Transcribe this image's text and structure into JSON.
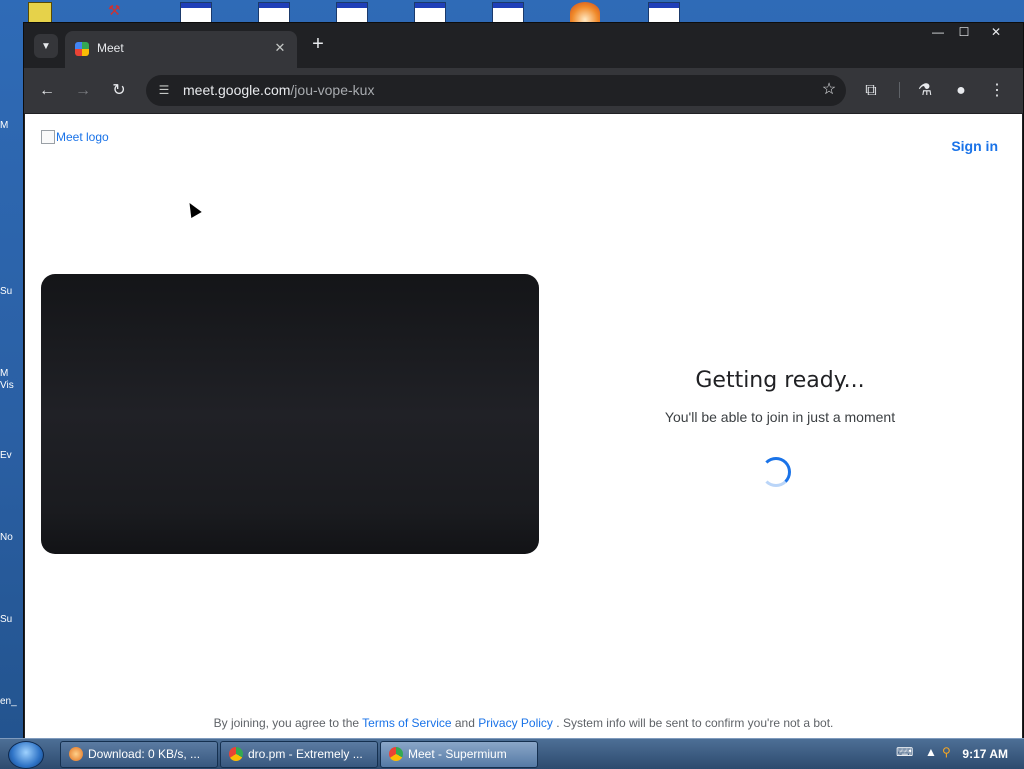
{
  "browser": {
    "tab_title": "Meet",
    "url_host": "meet.google.com",
    "url_path": "/jou-vope-kux"
  },
  "page": {
    "logo_alt": "Meet logo",
    "sign_in": "Sign in",
    "status_title": "Getting ready...",
    "status_subtitle": "You'll be able to join in just a moment",
    "footer": {
      "prefix": "By joining, you agree to the",
      "terms": "Terms of Service",
      "and": "and",
      "privacy": "Privacy Policy",
      "suffix": ". System info will be sent to confirm you're not a bot."
    }
  },
  "taskbar": {
    "tasks": [
      {
        "label": "Download: 0 KB/s, ..."
      },
      {
        "label": "dro.pm - Extremely ..."
      },
      {
        "label": "Meet - Supermium"
      }
    ],
    "clock": "9:17 AM"
  },
  "desktop": {
    "side_labels": [
      "M",
      "Su",
      "M",
      "Vis",
      "Ev",
      "No",
      "Su",
      "en_"
    ]
  },
  "colors": {
    "accent": "#1a73e8",
    "browser_frame": "#202124",
    "toolbar": "#35363a",
    "desktop": "#2a5fa3"
  }
}
